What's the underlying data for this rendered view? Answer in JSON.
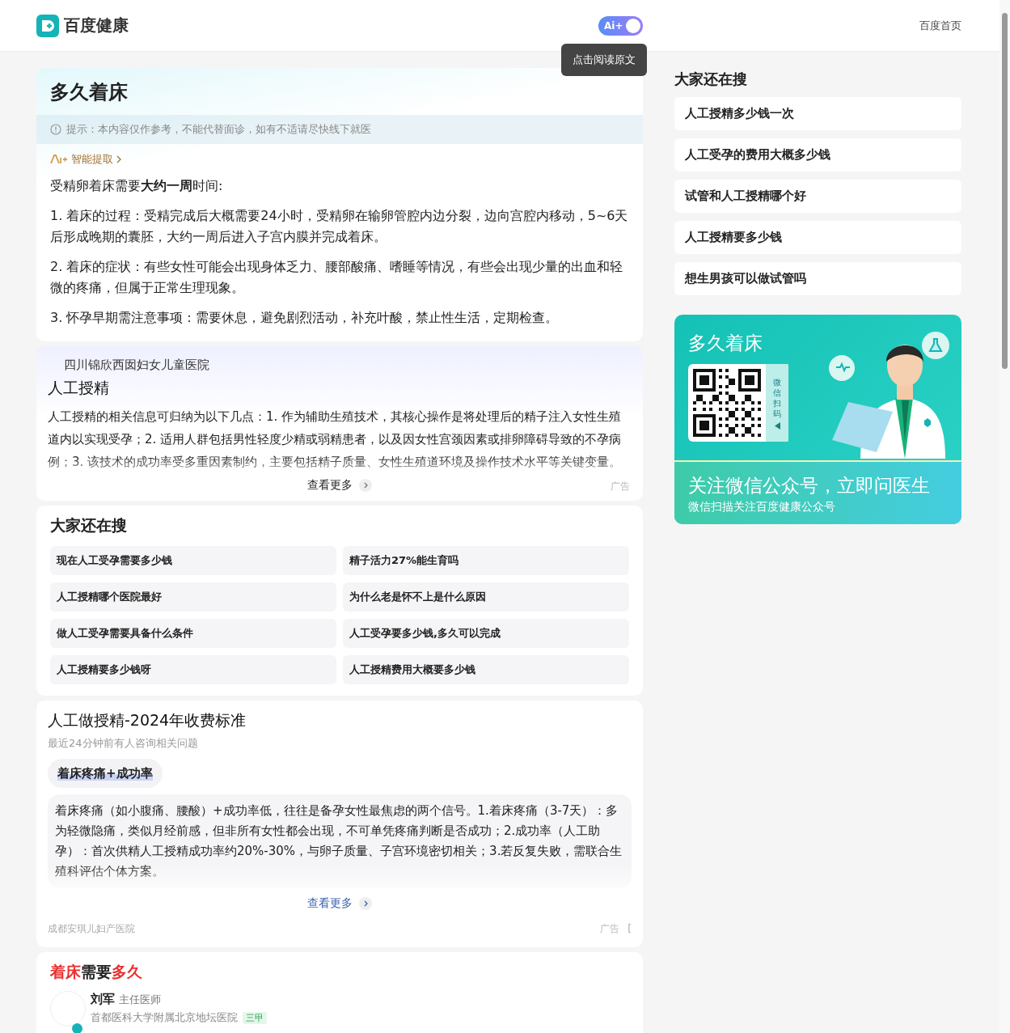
{
  "header": {
    "logo_text": "百度健康",
    "ai_toggle": {
      "label": "Ai+",
      "on": true
    },
    "tooltip": "点击阅读原文",
    "home_link": "百度首页"
  },
  "article": {
    "title": "多久着床",
    "notice": "提示：本内容仅作参考，不能代替面诊，如有不适请尽快线下就医",
    "ai_extract": "智能提取",
    "summary": "受精卵着床需要**大约一周**时间:",
    "points": [
      "1. 着床的过程：受精完成后大概需要24小时，受精卵在输卵管腔内边分裂，边向宫腔内移动，5~6天后形成晚期的囊胚，大约一周后进入子宫内膜并完成着床。",
      "2. 着床的症状：有些女性可能会出现身体乏力、腰部酸痛、嗜睡等情况，有些会出现少量的出血和轻微的疼痛，但属于正常生理现象。",
      "3. 怀孕早期需注意事项：需要休息，避免剧烈活动，补充叶酸，禁止性生活，定期检查。"
    ]
  },
  "ad1": {
    "hospital": "四川锦欣西囡妇女儿童医院",
    "title": "人工授精",
    "body": "人工授精的相关信息可归纳为以下几点：1. 作为辅助生殖技术，其核心操作是将处理后的精子注入女性生殖道内以实现受孕；2. 适用人群包括男性轻度少精或弱精患者，以及因女性宫颈因素或排卵障碍导致的不孕病例；3. 该技术的成功率受多重因素制约，主要包括精子质量、女性生殖道环境及操作技术水平等关键变量。",
    "more": "查看更多",
    "ad_label": "广告"
  },
  "related": {
    "title": "大家还在搜",
    "items": [
      "现在人工受孕需要多少钱",
      "精子活力27%能生育吗",
      "人工授精哪个医院最好",
      "为什么老是怀不上是什么原因",
      "做人工受孕需要具备什么条件",
      "人工受孕要多少钱,多久可以完成",
      "人工授精要多少钱呀",
      "人工授精费用大概要多少钱"
    ]
  },
  "ad2": {
    "title": "人工做授精-2024年收费标准",
    "subtitle": "最近24分钟前有人咨询相关问题",
    "tag": "着床疼痛+成功率",
    "body": "着床疼痛（如小腹痛、腰酸）+成功率低，往往是备孕女性最焦虑的两个信号。1.着床疼痛（3-7天）：多为轻微隐痛，类似月经前感，但非所有女性都会出现，不可单凭疼痛判断是否成功；2.成功率（人工助孕）：首次供精人工授精成功率约20%-30%，与卵子质量、子宫环境密切相关；3.若反复失败，需联合生殖科评估个体方案。",
    "more": "查看更多",
    "hospital": "成都安琪儿妇产医院",
    "ad_label": "广告",
    "corner_mark": "["
  },
  "doctor_card": {
    "title_parts": [
      {
        "text": "着床",
        "highlight": true
      },
      {
        "text": "需要",
        "highlight": false
      },
      {
        "text": "多久",
        "highlight": true
      }
    ],
    "doctor": {
      "name": "刘军",
      "title": "主任医师",
      "hospital": "首都医科大学附属北京地坛医院",
      "badge": "三甲",
      "verified": true
    }
  },
  "sidebar": {
    "title": "大家还在搜",
    "items": [
      "人工授精多少钱一次",
      "人工受孕的费用大概多少钱",
      "试管和人工授精哪个好",
      "人工授精要多少钱",
      "想生男孩可以做试管吗"
    ],
    "promo": {
      "title": "多久着床",
      "qr_label": "微信扫码",
      "headline": "关注微信公众号，立即问医生",
      "subline": "微信扫描关注百度健康公众号"
    }
  }
}
